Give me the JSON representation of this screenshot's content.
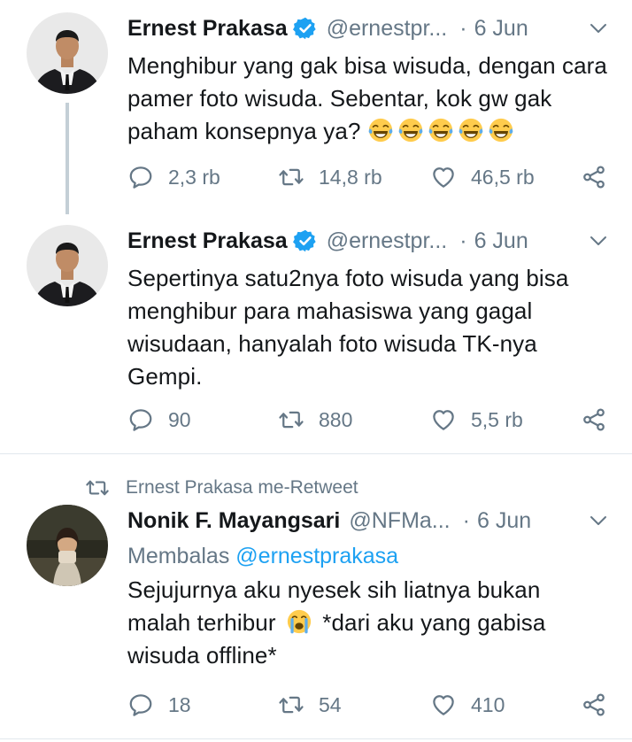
{
  "tweets": [
    {
      "name": "Ernest Prakasa",
      "handle": "@ernestpr...",
      "separator": "·",
      "date": "6 Jun",
      "text": "Menghibur yang gak bisa wisuda, dengan cara pamer foto wisuda. Sebentar, kok gw gak paham konsepnya ya?",
      "emoji": [
        "laughing-tears-emoji",
        "laughing-tears-emoji",
        "laughing-tears-emoji",
        "laughing-tears-emoji",
        "laughing-tears-emoji"
      ],
      "replies": "2,3 rb",
      "retweets": "14,8 rb",
      "likes": "46,5 rb"
    },
    {
      "name": "Ernest Prakasa",
      "handle": "@ernestpr...",
      "separator": "·",
      "date": "6 Jun",
      "text": "Sepertinya satu2nya foto wisuda yang bisa menghibur para mahasiswa yang gagal wisudaan, hanyalah foto wisuda TK-nya Gempi.",
      "replies": "90",
      "retweets": "880",
      "likes": "5,5 rb"
    },
    {
      "retweeted_by": "Ernest Prakasa me-Retweet",
      "name": "Nonik F. Mayangsari",
      "handle": "@NFMa...",
      "separator": "·",
      "date": "6 Jun",
      "reply_prefix": "Membalas",
      "reply_to": "@ernestprakasa",
      "text_before_emoji": "Sejujurnya aku nyesek sih liatnya bukan malah terhibur",
      "emoji": "crying-face-emoji",
      "text_after_emoji": "*dari aku yang gabisa wisuda offline*",
      "replies": "18",
      "retweets": "54",
      "likes": "410"
    }
  ],
  "colors": {
    "accent": "#1da1f2",
    "secondary": "#657786",
    "primary_text": "#14171a",
    "divider": "#e1e8ed",
    "thread_line": "#c4cfd6"
  },
  "icons": [
    "reply-icon",
    "retweet-icon",
    "like-icon",
    "share-icon",
    "verified-badge-icon",
    "chevron-down-icon",
    "retweet-small-icon"
  ]
}
